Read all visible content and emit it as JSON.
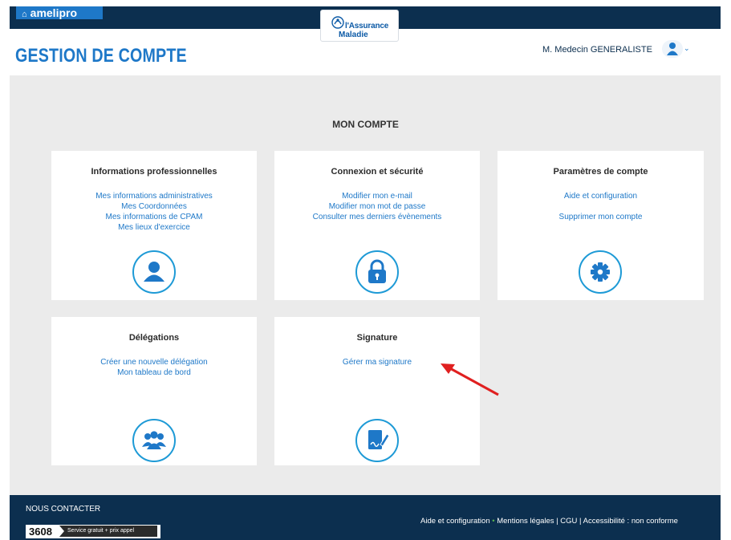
{
  "brand": {
    "name": "amelipro",
    "home_icon": "home-icon"
  },
  "logo": {
    "line1": "l'Assurance",
    "line2": "Maladie"
  },
  "header": {
    "title": "GESTION DE COMPTE",
    "user_name": "M. Medecin GENERALISTE",
    "user_icon": "user-icon",
    "chevron": "chevron-down-icon"
  },
  "main": {
    "section_title": "MON COMPTE",
    "cards": [
      {
        "title": "Informations professionnelles",
        "links": [
          "Mes informations administratives",
          "Mes Coordonnées",
          "Mes informations de CPAM",
          "Mes lieux d'exercice"
        ],
        "icon": "person-icon"
      },
      {
        "title": "Connexion et sécurité",
        "links": [
          "Modifier mon e-mail",
          "Modifier mon mot de passe",
          "Consulter mes derniers évènements"
        ],
        "icon": "lock-icon"
      },
      {
        "title": "Paramètres de compte",
        "links": [
          "Aide et configuration",
          "Supprimer mon compte"
        ],
        "icon": "gear-icon"
      },
      {
        "title": "Délégations",
        "links": [
          "Créer une nouvelle délégation",
          "Mon tableau de bord"
        ],
        "icon": "group-icon"
      },
      {
        "title": "Signature",
        "links": [
          "Gérer ma signature"
        ],
        "icon": "signature-icon"
      }
    ]
  },
  "annotation": {
    "icon": "red-arrow-icon",
    "color": "#e02020"
  },
  "footer": {
    "contact": "NOUS CONTACTER",
    "phone": "3608",
    "phone_tag": "Service gratuit + prix appel",
    "links": [
      "Aide et configuration",
      "Mentions légales",
      "CGU",
      "Accessibilité : non conforme"
    ]
  },
  "colors": {
    "accent": "#1e78c8",
    "navy": "#0c2f4f",
    "icon_ring": "#1e9ad6"
  }
}
